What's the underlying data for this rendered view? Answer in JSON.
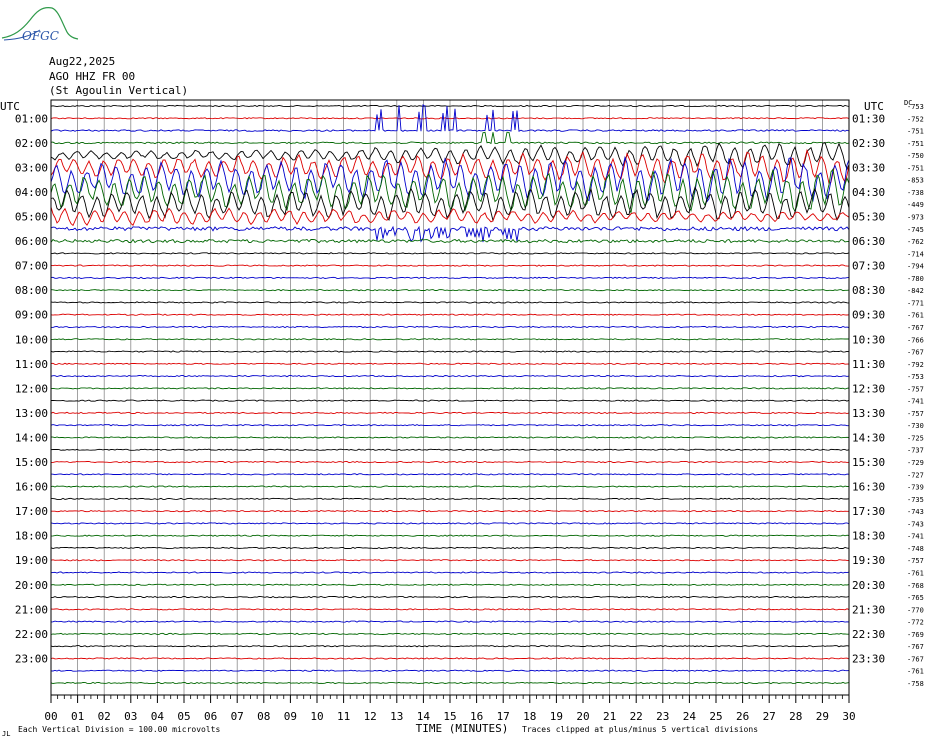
{
  "logo": {
    "text": "OFGC",
    "icon": "volcano-logo-icon",
    "color": "#2f9a4a",
    "text_color": "#2a55a8"
  },
  "header": {
    "date": "Aug22,2025",
    "station": "AGO HHZ FR 00",
    "name": "(St Agoulin Vertical)"
  },
  "chart_data": {
    "type": "seismogram helicorder",
    "left_axis_title": "UTC",
    "right_axis_title": "UTC",
    "right_column_title": "DC",
    "left_labels": [
      "01:00",
      "02:00",
      "03:00",
      "04:00",
      "05:00",
      "06:00",
      "07:00",
      "08:00",
      "09:00",
      "10:00",
      "11:00",
      "12:00",
      "13:00",
      "14:00",
      "15:00",
      "16:00",
      "17:00",
      "18:00",
      "19:00",
      "20:00",
      "21:00",
      "22:00",
      "23:00"
    ],
    "right_labels": [
      "01:30",
      "02:30",
      "03:30",
      "04:30",
      "05:30",
      "06:30",
      "07:30",
      "08:30",
      "09:30",
      "10:30",
      "11:30",
      "12:30",
      "13:30",
      "14:30",
      "15:30",
      "16:30",
      "17:30",
      "18:30",
      "19:30",
      "20:30",
      "21:30",
      "22:30",
      "23:30"
    ],
    "dc_offsets": [
      "-753",
      "-752",
      "-751",
      "-751",
      "-750",
      "-751",
      "-853",
      "-738",
      "-449",
      "-973",
      "-745",
      "-762",
      "-714",
      "-794",
      "-780",
      "-842",
      "-771",
      "-761",
      "-767",
      "-766",
      "-767",
      "-792",
      "-753",
      "-757",
      "-741",
      "-757",
      "-730",
      "-725",
      "-737",
      "-729",
      "-727",
      "-739",
      "-735",
      "-743",
      "-743",
      "-741",
      "-748",
      "-757",
      "-761",
      "-768",
      "-765",
      "-770",
      "-772",
      "-769",
      "-767",
      "-767",
      "-761",
      "-758"
    ],
    "trace_colors": [
      "#000000",
      "#dd0000",
      "#0000cc",
      "#006600"
    ],
    "x_ticks": [
      "00",
      "01",
      "02",
      "03",
      "04",
      "05",
      "06",
      "07",
      "08",
      "09",
      "10",
      "11",
      "12",
      "13",
      "14",
      "15",
      "16",
      "17",
      "18",
      "19",
      "20",
      "21",
      "22",
      "23",
      "24",
      "25",
      "26",
      "27",
      "28",
      "29",
      "30"
    ],
    "x_label": "TIME (MINUTES)",
    "xlim": [
      0,
      30
    ],
    "trace_count": 48,
    "grid": true,
    "footer_left": "Each Vertical Division =  100.00 microvolts",
    "footer_right": "Traces clipped at plus/minus 5 vertical divisions",
    "corner_mark": "JL"
  }
}
